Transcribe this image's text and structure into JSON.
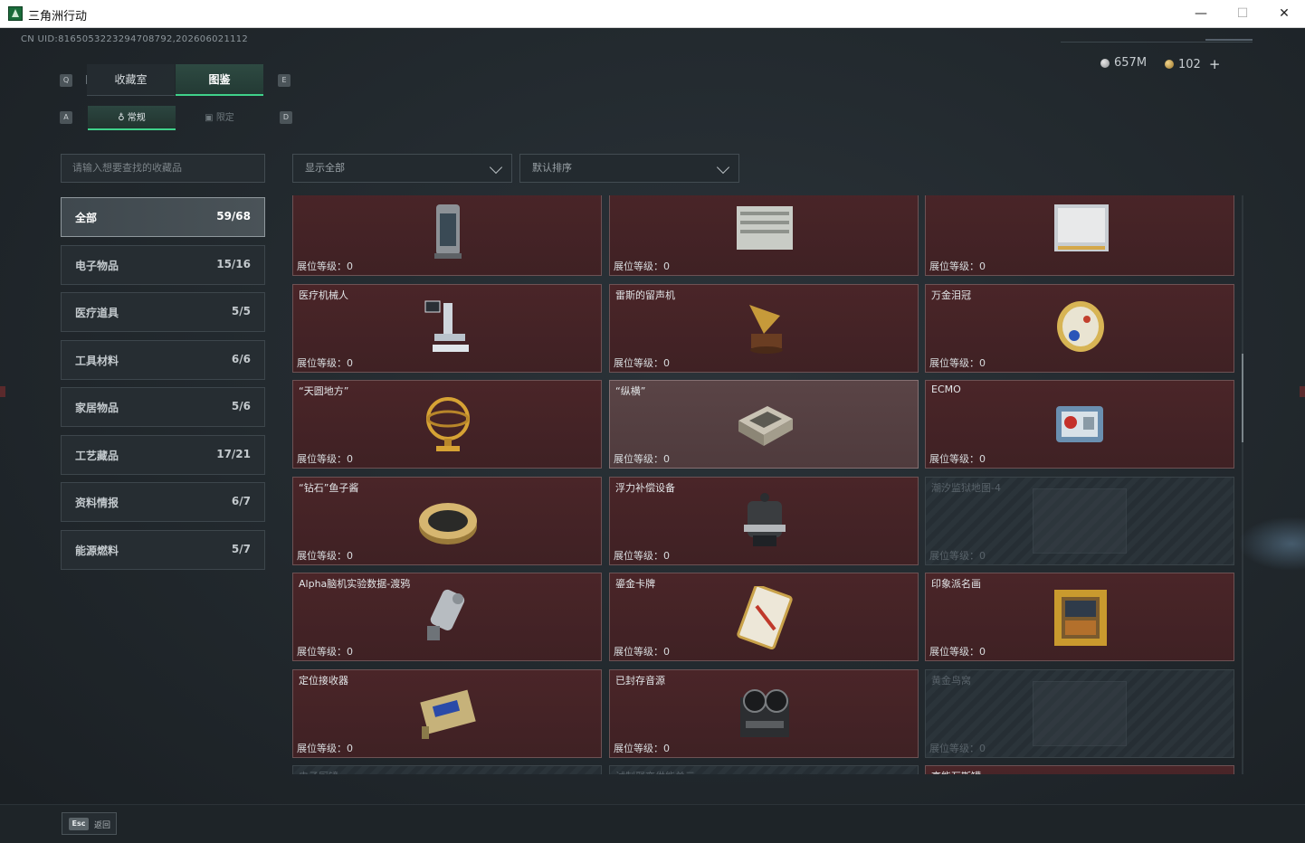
{
  "window": {
    "title": "三角洲行动",
    "minimize": "—",
    "maximize": "☐",
    "close": "✕"
  },
  "header": {
    "uid": "CN UID:8165053223294708792,202606021112",
    "currency": [
      {
        "icon": "silver-coin-icon",
        "value": "657M"
      },
      {
        "icon": "gold-coin-icon",
        "value": "102"
      }
    ],
    "plus": "+"
  },
  "key_hints": {
    "q": "Q",
    "e": "E",
    "a": "A",
    "d": "D"
  },
  "tabs": [
    {
      "label": "收藏室",
      "active": false
    },
    {
      "label": "图鉴",
      "active": true
    }
  ],
  "subtabs": [
    {
      "label": "常规",
      "active": true
    },
    {
      "label": "限定",
      "active": false
    }
  ],
  "search": {
    "placeholder": "请输入想要查找的收藏品"
  },
  "filters": {
    "show": "显示全部",
    "sort": "默认排序"
  },
  "categories": [
    {
      "label": "全部",
      "count": "59/68",
      "active": true
    },
    {
      "label": "电子物品",
      "count": "15/16",
      "active": false
    },
    {
      "label": "医疗道具",
      "count": "5/5",
      "active": false
    },
    {
      "label": "工具材料",
      "count": "6/6",
      "active": false
    },
    {
      "label": "家居物品",
      "count": "5/6",
      "active": false
    },
    {
      "label": "工艺藏品",
      "count": "17/21",
      "active": false
    },
    {
      "label": "资料情报",
      "count": "6/7",
      "active": false
    },
    {
      "label": "能源燃料",
      "count": "5/7",
      "active": false
    }
  ],
  "items": [
    {
      "name": "",
      "level": "展位等级：0",
      "state": "owned",
      "icon": "lantern-device-icon"
    },
    {
      "name": "",
      "level": "展位等级：0",
      "state": "owned",
      "icon": "server-box-icon"
    },
    {
      "name": "",
      "level": "展位等级：0",
      "state": "owned",
      "icon": "battery-pack-icon"
    },
    {
      "name": "医疗机械人",
      "level": "展位等级：0",
      "state": "owned",
      "icon": "medical-robot-icon"
    },
    {
      "name": "雷斯的留声机",
      "level": "展位等级：0",
      "state": "owned",
      "icon": "gramophone-icon"
    },
    {
      "name": "万金泪冠",
      "level": "展位等级：0",
      "state": "owned",
      "icon": "jeweled-egg-icon"
    },
    {
      "name": "“天圆地方”",
      "level": "展位等级：0",
      "state": "owned",
      "icon": "armillary-sphere-icon"
    },
    {
      "name": "“纵横”",
      "level": "展位等级：0",
      "state": "highlighted",
      "icon": "chess-box-icon"
    },
    {
      "name": "ECMO",
      "level": "展位等级：0",
      "state": "owned",
      "icon": "ecmo-machine-icon"
    },
    {
      "name": "“钻石”鱼子酱",
      "level": "展位等级：0",
      "state": "owned",
      "icon": "caviar-tin-icon"
    },
    {
      "name": "浮力补偿设备",
      "level": "展位等级：0",
      "state": "owned",
      "icon": "diving-gear-icon"
    },
    {
      "name": "潮汐监狱地图-4",
      "level": "展位等级：0",
      "state": "locked",
      "icon": "map-icon"
    },
    {
      "name": "Alpha脑机实验数据-渡鸦",
      "level": "展位等级：0",
      "state": "owned",
      "icon": "data-canister-icon"
    },
    {
      "name": "鎏金卡牌",
      "level": "展位等级：0",
      "state": "owned",
      "icon": "gold-card-icon"
    },
    {
      "name": "印象派名画",
      "level": "展位等级：0",
      "state": "owned",
      "icon": "framed-painting-icon"
    },
    {
      "name": "定位接收器",
      "level": "展位等级：0",
      "state": "owned",
      "icon": "receiver-module-icon"
    },
    {
      "name": "已封存音源",
      "level": "展位等级：0",
      "state": "owned",
      "icon": "reel-recorder-icon"
    },
    {
      "name": "黄金鸟窝",
      "level": "展位等级：0",
      "state": "locked",
      "icon": "bird-nest-icon"
    },
    {
      "name": "电子厨镜",
      "level": "",
      "state": "locked",
      "icon": "unknown-icon"
    },
    {
      "name": "试制聚变供能单元",
      "level": "",
      "state": "locked",
      "icon": "unknown-icon"
    },
    {
      "name": "高能瓦斯罐",
      "level": "",
      "state": "owned",
      "icon": "gas-canister-icon"
    }
  ],
  "footer": {
    "key": "Esc",
    "label": "返回"
  },
  "colors": {
    "accent": "#3fd18a",
    "tile_owned": "#4a2528",
    "tile_locked": "#262e34"
  }
}
